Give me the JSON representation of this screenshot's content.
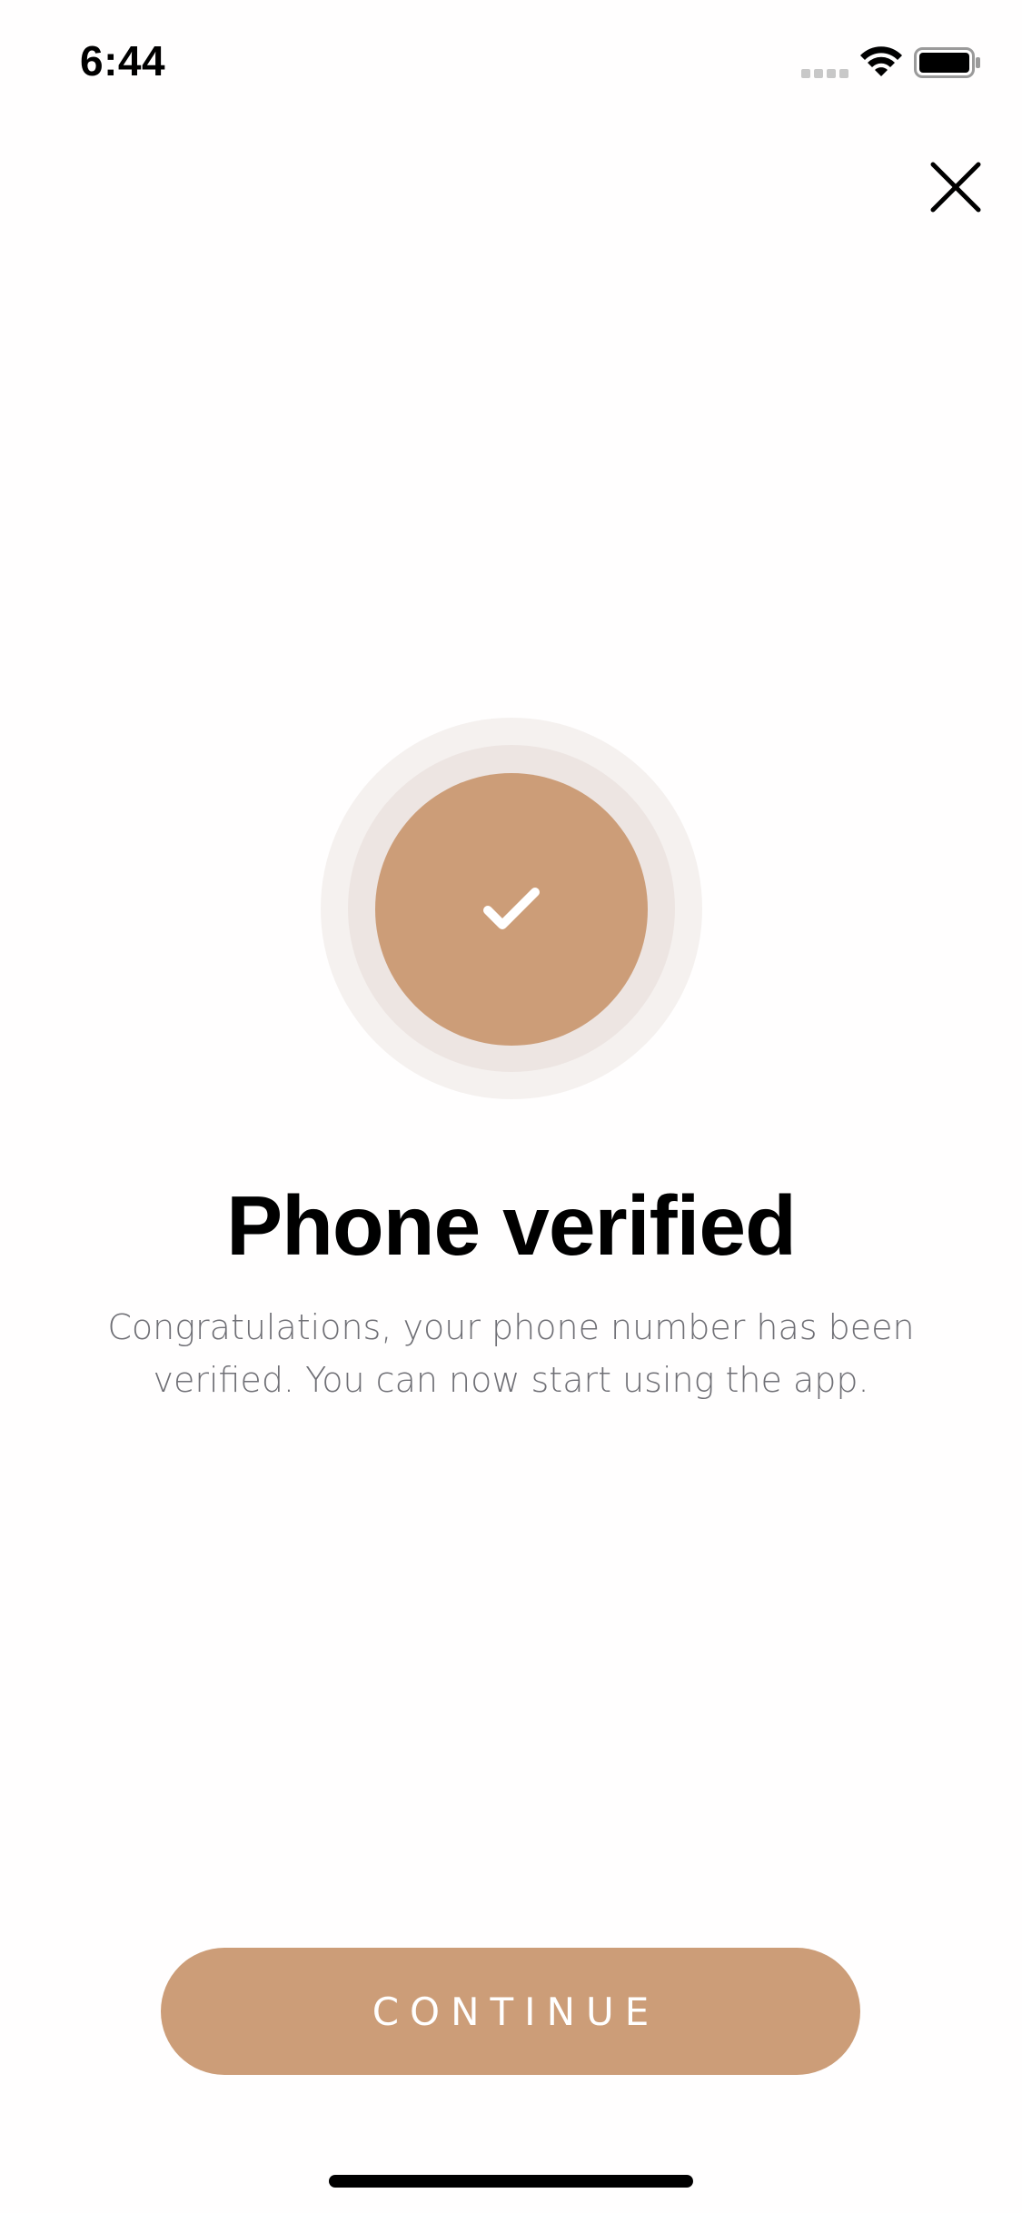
{
  "status_bar": {
    "time": "6:44",
    "icons": [
      "signal-icon",
      "wifi-icon",
      "battery-icon"
    ]
  },
  "header": {
    "close_icon": "close-icon"
  },
  "badge": {
    "icon": "checkmark-icon"
  },
  "main": {
    "title": "Phone verified",
    "subtitle": "Congratulations, your phone number has been verified. You can now start using the app."
  },
  "footer": {
    "continue_label": "CONTINUE"
  },
  "colors": {
    "accent": "#cc9d78",
    "badge_ring_outer": "#f5f1ef",
    "badge_ring_mid": "#ede5e2",
    "subtitle_text": "#6f6f75",
    "background": "#fffefe"
  }
}
